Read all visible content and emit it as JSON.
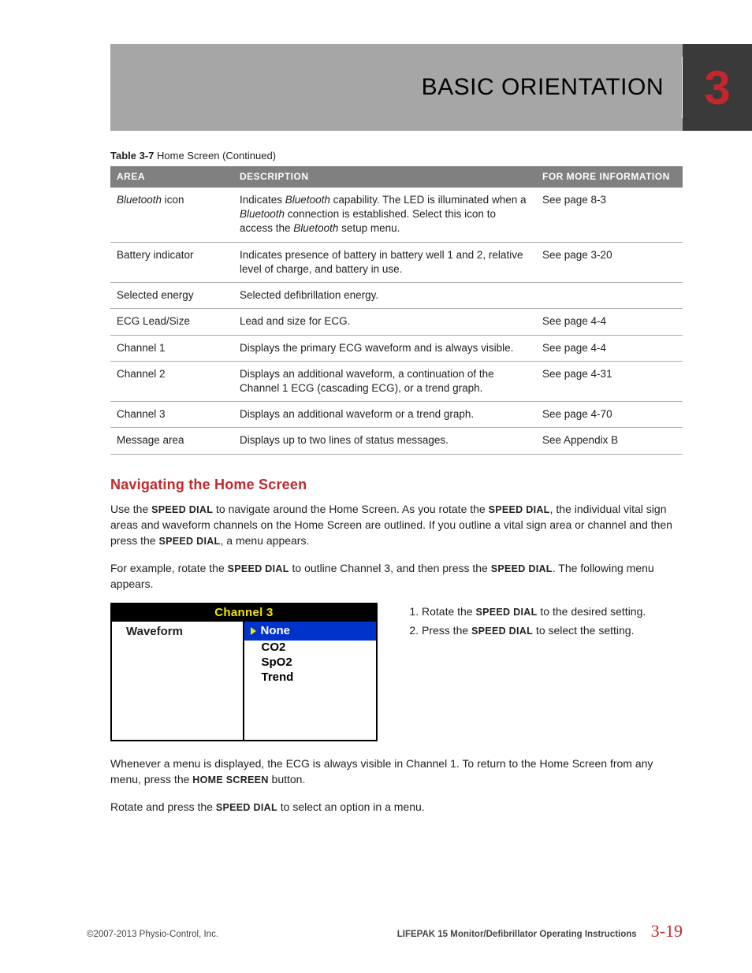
{
  "header": {
    "title": "BASIC ORIENTATION",
    "chapter_num": "3"
  },
  "table": {
    "caption_bold": "Table 3-7",
    "caption_rest": " Home Screen (Continued)",
    "headers": {
      "area": "AREA",
      "description": "DESCRIPTION",
      "info": "FOR MORE INFORMATION"
    },
    "rows": [
      {
        "area_html": "<span class='italic'>Bluetooth</span> icon",
        "desc_html": "Indicates <span class='italic'>Bluetooth</span> capability. The LED is illuminated when a <span class='italic'>Bluetooth</span> connection is established. Select this icon to access the <span class='italic'>Bluetooth</span> setup menu.",
        "info": "See page 8-3"
      },
      {
        "area_html": "Battery indicator",
        "desc_html": "Indicates presence of battery in battery well 1 and 2, relative level of charge, and battery in use.",
        "info": "See page 3-20"
      },
      {
        "area_html": "Selected energy",
        "desc_html": "Selected defibrillation energy.",
        "info": ""
      },
      {
        "area_html": "ECG Lead/Size",
        "desc_html": "Lead and size for ECG.",
        "info": "See page 4-4"
      },
      {
        "area_html": "Channel 1",
        "desc_html": "Displays the primary ECG waveform and is always visible.",
        "info": "See page 4-4"
      },
      {
        "area_html": "Channel 2",
        "desc_html": "Displays an additional waveform, a continuation of the Channel 1 ECG (cascading ECG), or a trend graph.",
        "info": "See page 4-31"
      },
      {
        "area_html": "Channel 3",
        "desc_html": "Displays an additional waveform or a trend graph.",
        "info": "See page 4-70"
      },
      {
        "area_html": "Message area",
        "desc_html": "Displays up to two lines of status messages.",
        "info": "See Appendix B"
      }
    ]
  },
  "section": {
    "heading": "Navigating the Home Screen",
    "p1_parts": [
      "Use the ",
      "SPEED DIAL",
      " to navigate around the Home Screen. As you rotate the ",
      "SPEED DIAL",
      ", the individual vital sign areas and waveform channels on the Home Screen are outlined. If you outline a vital sign area or channel and then press the ",
      "SPEED DIAL",
      ", a menu appears."
    ],
    "p2_parts": [
      "For example, rotate the ",
      "SPEED DIAL",
      " to outline Channel 3, and then press the ",
      "SPEED DIAL",
      ". The following menu appears."
    ],
    "p3_parts": [
      "Whenever a menu is displayed, the ECG is always visible in Channel 1. To return to the Home Screen from any menu, press the ",
      "HOME SCREEN",
      " button."
    ],
    "p4_parts": [
      "Rotate and press the ",
      "SPEED DIAL",
      " to select an option in a menu."
    ]
  },
  "menu": {
    "title": "Channel 3",
    "left_label": "Waveform",
    "selected": "None",
    "options": [
      "CO2",
      "SpO2",
      "Trend"
    ]
  },
  "steps": [
    {
      "pre": "Rotate the ",
      "sc": "SPEED DIAL",
      "post": " to the desired setting."
    },
    {
      "pre": "Press the ",
      "sc": "SPEED DIAL",
      "post": " to select the setting."
    }
  ],
  "footer": {
    "copyright": "©2007-2013 Physio-Control, Inc.",
    "doc_title": "LIFEPAK 15 Monitor/Defibrillator Operating Instructions",
    "page": "3-19"
  }
}
